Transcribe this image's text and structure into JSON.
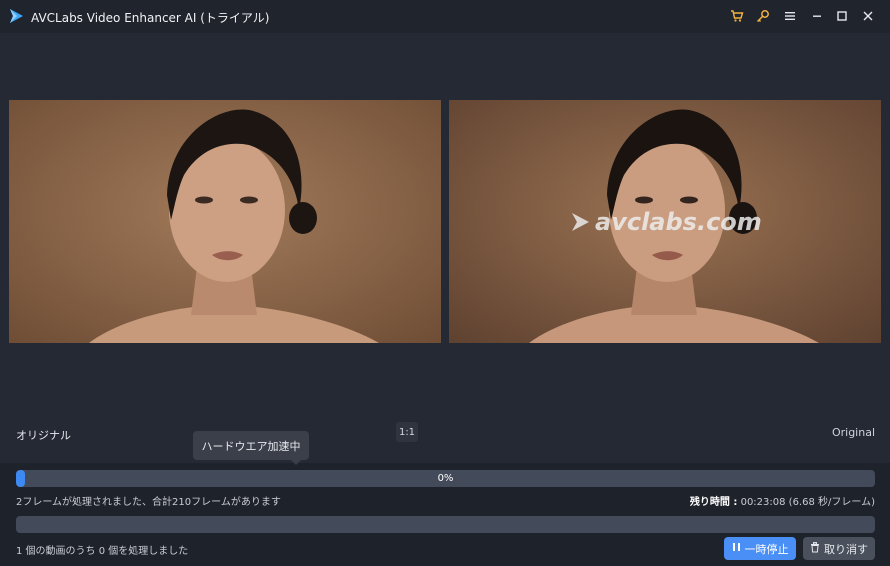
{
  "window": {
    "title": "AVCLabs Video Enhancer AI (トライアル)",
    "accent": "#3d8bf2",
    "icons": [
      "app-logo-icon",
      "cart-icon",
      "key-icon",
      "menu-icon",
      "minimize-icon",
      "maximize-icon",
      "close-icon"
    ]
  },
  "preview": {
    "left_label": "オリジナル",
    "right_label": "Original",
    "ratio": "1:1",
    "watermark": "avclabs.com"
  },
  "tooltip": {
    "text": "ハードウエア加速中"
  },
  "progress": {
    "percent_text": "0%",
    "fraction": 0.01,
    "frames_text": "2フレームが処理されました、合計210フレームがあります",
    "remaining_label": "残り時間 :",
    "remaining_value": "00:23:08 (6.68 秒/フレーム)"
  },
  "overall": {
    "files_text": "1 個の動画のうち 0 個を処理しました"
  },
  "buttons": {
    "pause": "一時停止",
    "cancel": "取り消す"
  }
}
